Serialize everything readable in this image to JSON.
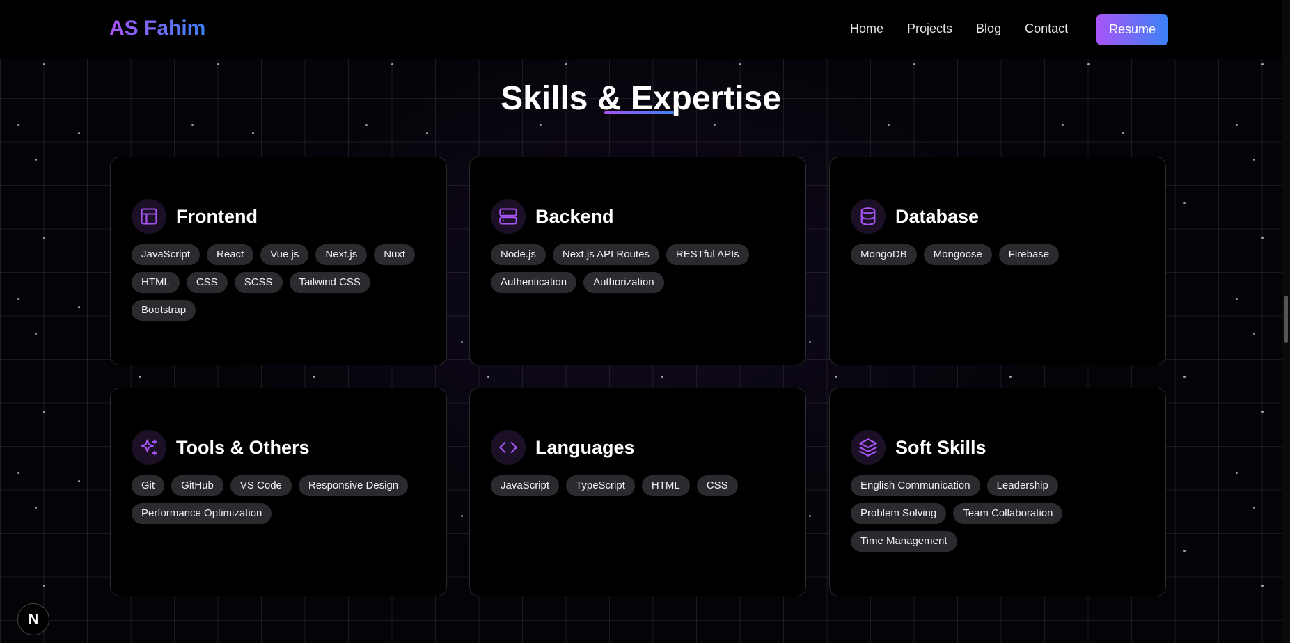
{
  "header": {
    "brand": "AS Fahim",
    "nav": [
      "Home",
      "Projects",
      "Blog",
      "Contact"
    ],
    "resume_label": "Resume"
  },
  "section": {
    "title": "Skills & Expertise"
  },
  "cards": [
    {
      "title": "Frontend",
      "icon": "layout-icon",
      "tags": [
        "JavaScript",
        "React",
        "Vue.js",
        "Next.js",
        "Nuxt",
        "HTML",
        "CSS",
        "SCSS",
        "Tailwind CSS",
        "Bootstrap"
      ]
    },
    {
      "title": "Backend",
      "icon": "server-icon",
      "tags": [
        "Node.js",
        "Next.js API Routes",
        "RESTful APIs",
        "Authentication",
        "Authorization"
      ]
    },
    {
      "title": "Database",
      "icon": "database-icon",
      "tags": [
        "MongoDB",
        "Mongoose",
        "Firebase"
      ]
    },
    {
      "title": "Tools & Others",
      "icon": "sparkles-icon",
      "tags": [
        "Git",
        "GitHub",
        "VS Code",
        "Responsive Design",
        "Performance Optimization"
      ]
    },
    {
      "title": "Languages",
      "icon": "code-icon",
      "tags": [
        "JavaScript",
        "TypeScript",
        "HTML",
        "CSS"
      ]
    },
    {
      "title": "Soft Skills",
      "icon": "layers-icon",
      "tags": [
        "English Communication",
        "Leadership",
        "Problem Solving",
        "Team Collaboration",
        "Time Management"
      ]
    }
  ],
  "badge": "N",
  "colors": {
    "accent_purple": "#a855f7",
    "accent_blue": "#3b82f6",
    "tag_bg": "#2b2b2f"
  }
}
